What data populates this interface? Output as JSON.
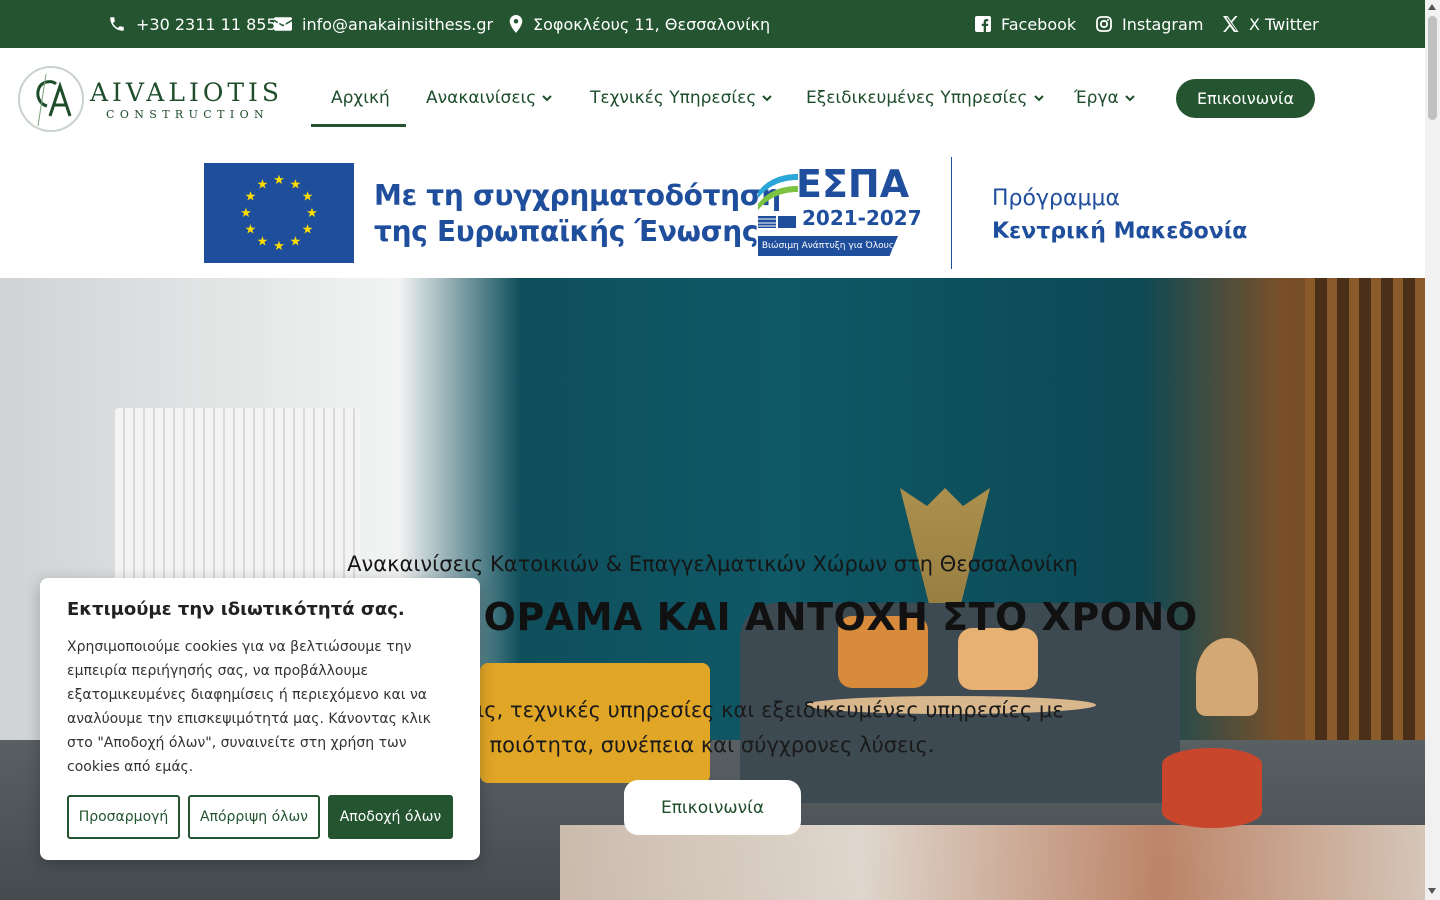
{
  "topbar": {
    "phone": "+30 2311 11 8550",
    "email": "info@anakainisithess.gr",
    "address": "Σοφοκλέους 11, Θεσσαλονίκη",
    "social": [
      {
        "label": "Facebook",
        "icon": "facebook-icon"
      },
      {
        "label": "Instagram",
        "icon": "instagram-icon"
      },
      {
        "label": "X Twitter",
        "icon": "x-twitter-icon"
      }
    ]
  },
  "logo": {
    "name": "AIVALIOTIS",
    "sub": "CONSTRUCTION"
  },
  "nav": {
    "items": [
      {
        "label": "Αρχική",
        "active": true
      },
      {
        "label": "Ανακαινίσεις",
        "dropdown": true
      },
      {
        "label": "Τεχνικές Υπηρεσίες",
        "dropdown": true
      },
      {
        "label": "Εξειδικευμένες Υπηρεσίες",
        "dropdown": true
      },
      {
        "label": "Έργα",
        "dropdown": true
      }
    ],
    "cta": "Επικοινωνία"
  },
  "espa": {
    "line1": "Με τη συγχρηματοδότηση",
    "line2": "της Ευρωπαϊκής Ένωσης",
    "logo_word": "ΕΣΠΑ",
    "logo_years": "2021-2027",
    "logo_tag": "Βιώσιμη Ανάπτυξη για Όλους",
    "program_line1": "Πρόγραμμα",
    "program_line2": "Κεντρική Μακεδονία"
  },
  "hero": {
    "subtitle": "Ανακαινίσεις Κατοικιών & Επαγγελματικών Χώρων στη Θεσσαλονίκη",
    "title": "ΠΟΙΟΤΗΤΑ, ΟΡΑΜΑ ΚΑΙ ΑΝΤΟΧΗ ΣΤΟ ΧΡΟΝΟ",
    "description": "Ανακαινίσεις, τεχνικές υπηρεσίες και εξειδικευμένες υπηρεσίες με ποιότητα, συνέπεια και σύγχρονες λύσεις.",
    "button": "Επικοινωνία"
  },
  "cookie": {
    "title": "Εκτιμούμε την ιδιωτικότητά σας.",
    "text": "Χρησιμοποιούμε cookies για να βελτιώσουμε την εμπειρία περιήγησής σας, να προβάλλουμε εξατομικευμένες διαφημίσεις ή περιεχόμενο και να αναλύουμε την επισκεψιμότητά μας. Κάνοντας κλικ στο \"Αποδοχή όλων\", συναινείτε στη χρήση των cookies από εμάς.",
    "customize": "Προσαρμογή",
    "reject": "Απόρριψη όλων",
    "accept": "Αποδοχή όλων"
  },
  "colors": {
    "brand_green": "#245530",
    "espa_blue": "#1f4e9c",
    "eu_star": "#ffdd00"
  }
}
